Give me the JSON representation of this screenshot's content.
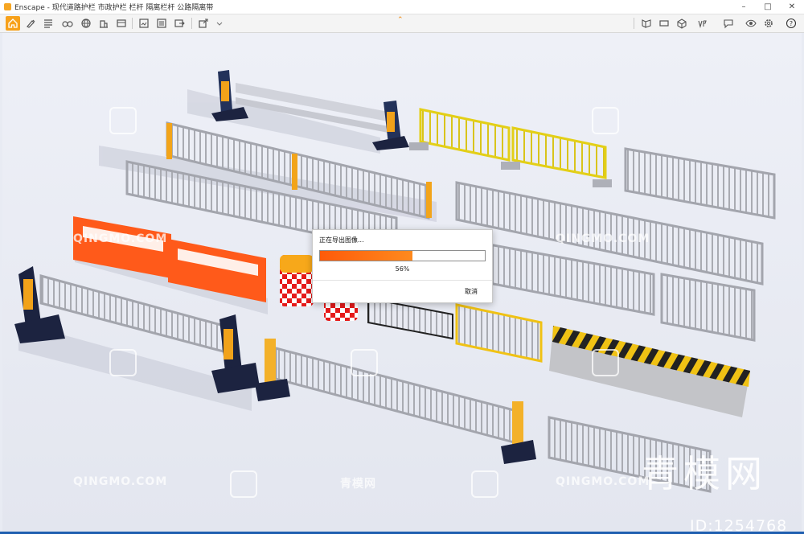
{
  "window": {
    "title": "Enscape - 现代道路护栏 市政护栏 栏杆 隔离栏杆 公路隔离带",
    "minimize": "–",
    "maximize": "□",
    "close": "✕"
  },
  "toolbar": {
    "left_icons": [
      "home-icon",
      "brush-icon",
      "list-icon",
      "binoculars-icon",
      "building-icon",
      "film-icon",
      "screenshot-icon",
      "batch-render-icon",
      "export-icon",
      "upload-icon"
    ],
    "right_icons": [
      "asset-library-icon",
      "panorama-icon",
      "cube-icon",
      "vr-icon",
      "feedback-icon",
      "eye-icon",
      "settings-icon",
      "help-icon"
    ],
    "collapse": "⌃"
  },
  "watermarks": {
    "site": "QINGMO.COM",
    "brand": "青模网",
    "big": "青模网",
    "id": "ID:1254768"
  },
  "dialog": {
    "title": "正在导出图像...",
    "progress": 0.56,
    "percent_text": "56%",
    "cancel": "取消"
  },
  "colors": {
    "accent": "#f7a11a",
    "progress": "#ff6a10",
    "orange_barrier": "#ff5a1a",
    "yellow_fence": "#e8d21c"
  }
}
